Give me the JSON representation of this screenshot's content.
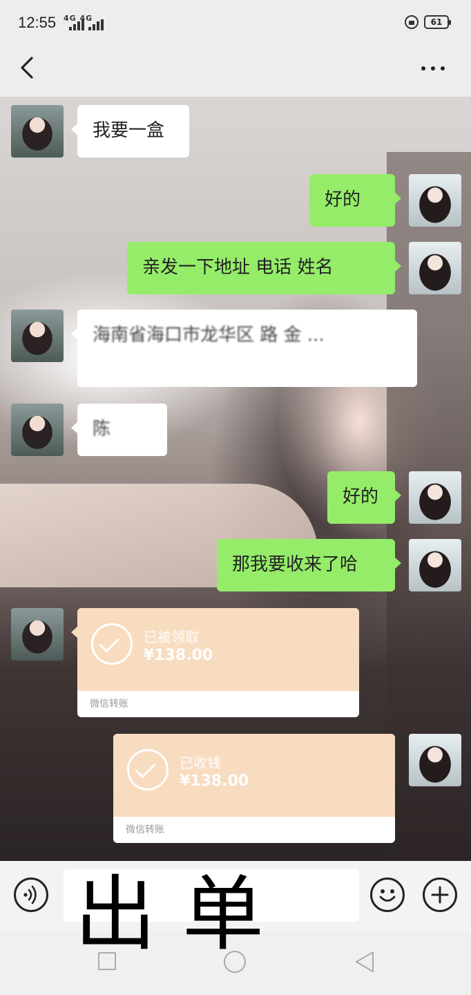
{
  "status_bar": {
    "time": "12:55",
    "network_label": "4G 4G",
    "battery": "61"
  },
  "header": {
    "title": "",
    "more_icon": "more-dots-icon",
    "back_icon": "chevron-left-icon"
  },
  "messages": [
    {
      "side": "in",
      "text": "我要一盒"
    },
    {
      "side": "out",
      "text": "好的"
    },
    {
      "side": "out",
      "text": "亲发一下地址 电话 姓名"
    },
    {
      "side": "in",
      "text": "海南省海口市龙华区 路 金 ..."
    },
    {
      "side": "in",
      "text": "陈"
    },
    {
      "side": "out",
      "text": "好的"
    },
    {
      "side": "out",
      "text": "那我要收来了哈"
    }
  ],
  "transfers": [
    {
      "side": "in",
      "status": "已被领取",
      "amount": "¥138.00",
      "footer": "微信转账"
    },
    {
      "side": "out",
      "status": "已收钱",
      "amount": "¥138.00",
      "footer": "微信转账"
    }
  ],
  "input_bar": {
    "placeholder": "",
    "voice_icon": "voice-icon",
    "emoji_icon": "emoji-icon",
    "plus_icon": "plus-icon"
  },
  "overlay_text": "出单",
  "colors": {
    "out_bubble": "#95ec69",
    "in_bubble": "#ffffff",
    "transfer": "#f8dcc0",
    "bar": "#ededed"
  }
}
